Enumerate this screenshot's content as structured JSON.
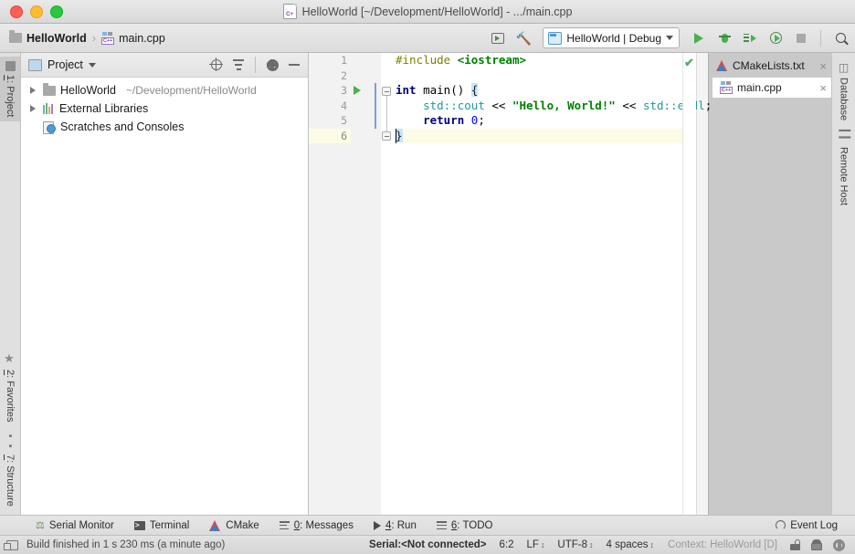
{
  "window": {
    "title": "HelloWorld [~/Development/HelloWorld] - .../main.cpp",
    "traffic_lights": [
      "close",
      "minimize",
      "zoom"
    ]
  },
  "navbar": {
    "breadcrumb": [
      {
        "label": "HelloWorld",
        "icon": "folder-icon"
      },
      {
        "label": "main.cpp",
        "icon": "cpp-file-icon"
      }
    ],
    "separator": "›",
    "run_config": {
      "label": "HelloWorld | Debug",
      "icon": "run-config-icon",
      "caret": "chevron-down-icon"
    },
    "buttons": [
      "screen-toggle-icon",
      "build-hammer-icon",
      "run-button",
      "debug-button",
      "run-with-step-button",
      "run-with-coverage-button",
      "stop-button",
      "search-everywhere-button"
    ]
  },
  "left_strip": {
    "tabs": [
      {
        "num": "1",
        "label": ": Project",
        "active": true,
        "icon": "project-icon"
      },
      {
        "num": "2",
        "label": ": Favorites",
        "active": false,
        "icon": "star-icon"
      },
      {
        "num": "7",
        "label": ": Structure",
        "active": false,
        "icon": "structure-icon"
      }
    ]
  },
  "right_strip": {
    "tabs": [
      {
        "label": "Database",
        "icon": "database-icon"
      },
      {
        "label": "Remote Host",
        "icon": "remote-host-icon"
      }
    ]
  },
  "project_panel": {
    "title": "Project",
    "title_caret": "chevron-down-icon",
    "toolbar": [
      "locate-icon",
      "collapse-all-icon",
      "settings-gear-icon",
      "minimize-icon"
    ],
    "tree": [
      {
        "label": "HelloWorld",
        "path": "~/Development/HelloWorld",
        "icon": "folder-icon",
        "expandable": true
      },
      {
        "label": "External Libraries",
        "path": "",
        "icon": "library-icon",
        "expandable": true
      },
      {
        "label": "Scratches and Consoles",
        "path": "",
        "icon": "scratches-icon",
        "expandable": false
      }
    ]
  },
  "editor": {
    "line_numbers": [
      "1",
      "2",
      "3",
      "4",
      "5",
      "6"
    ],
    "current_line": 6,
    "run_gutter_line": 3,
    "inspection_status": "✔",
    "lines": [
      {
        "n": 1,
        "tokens": [
          {
            "t": "#include ",
            "c": "k-pre"
          },
          {
            "t": "<iostream>",
            "c": "k-inc"
          }
        ]
      },
      {
        "n": 2,
        "tokens": []
      },
      {
        "n": 3,
        "tokens": [
          {
            "t": "int",
            "c": "k-kw"
          },
          {
            "t": " ",
            "c": "k-op"
          },
          {
            "t": "main",
            "c": "k-fn"
          },
          {
            "t": "() ",
            "c": "k-op"
          },
          {
            "t": "{",
            "c": "brace-hl"
          }
        ]
      },
      {
        "n": 4,
        "tokens": [
          {
            "t": "    ",
            "c": "k-op"
          },
          {
            "t": "std::cout",
            "c": "k-ns"
          },
          {
            "t": " << ",
            "c": "k-op"
          },
          {
            "t": "\"Hello, World!\"",
            "c": "k-str"
          },
          {
            "t": " << ",
            "c": "k-op"
          },
          {
            "t": "std::endl",
            "c": "k-ns"
          },
          {
            "t": ";",
            "c": "k-op"
          }
        ]
      },
      {
        "n": 5,
        "tokens": [
          {
            "t": "    ",
            "c": "k-op"
          },
          {
            "t": "return",
            "c": "k-kw"
          },
          {
            "t": " ",
            "c": "k-op"
          },
          {
            "t": "0",
            "c": "k-num"
          },
          {
            "t": ";",
            "c": "k-op"
          }
        ]
      },
      {
        "n": 6,
        "tokens": [
          {
            "t": "}",
            "c": "brace-hl"
          }
        ]
      }
    ]
  },
  "file_tabs": [
    {
      "label": "CMakeLists.txt",
      "icon": "cmake-icon",
      "active": false,
      "close": "×"
    },
    {
      "label": "main.cpp",
      "icon": "cpp-file-icon",
      "active": true,
      "close": "×"
    }
  ],
  "bottom_toolwindows": [
    {
      "label": "Serial Monitor",
      "num": "",
      "icon": "serial-monitor-icon"
    },
    {
      "label": "Terminal",
      "num": "",
      "icon": "terminal-icon"
    },
    {
      "label": "CMake",
      "num": "",
      "icon": "cmake-icon"
    },
    {
      "label": ": Messages",
      "num": "0",
      "icon": "messages-icon"
    },
    {
      "label": ": Run",
      "num": "4",
      "icon": "run-icon"
    },
    {
      "label": ": TODO",
      "num": "6",
      "icon": "todo-icon"
    }
  ],
  "event_log": {
    "label": "Event Log",
    "icon": "event-log-icon"
  },
  "statusbar": {
    "build_message": "Build finished in 1 s 230 ms (a minute ago)",
    "serial": "Serial:<Not connected>",
    "caret_position": "6:2",
    "line_separator": "LF",
    "encoding": "UTF-8",
    "indent": "4 spaces",
    "context": "Context: HelloWorld [D]",
    "stepper_glyph": "↕",
    "icons": [
      "lock-icon",
      "robot-icon",
      "gear-help-icon"
    ]
  },
  "colors": {
    "accent_green": "#4caf50",
    "keyword": "#000080",
    "string": "#008000",
    "namespace": "#20999d",
    "preprocessor": "#808000",
    "number": "#0000ff",
    "current_line_bg": "#fcfbe6",
    "panel_bg": "#c9c9c9"
  }
}
